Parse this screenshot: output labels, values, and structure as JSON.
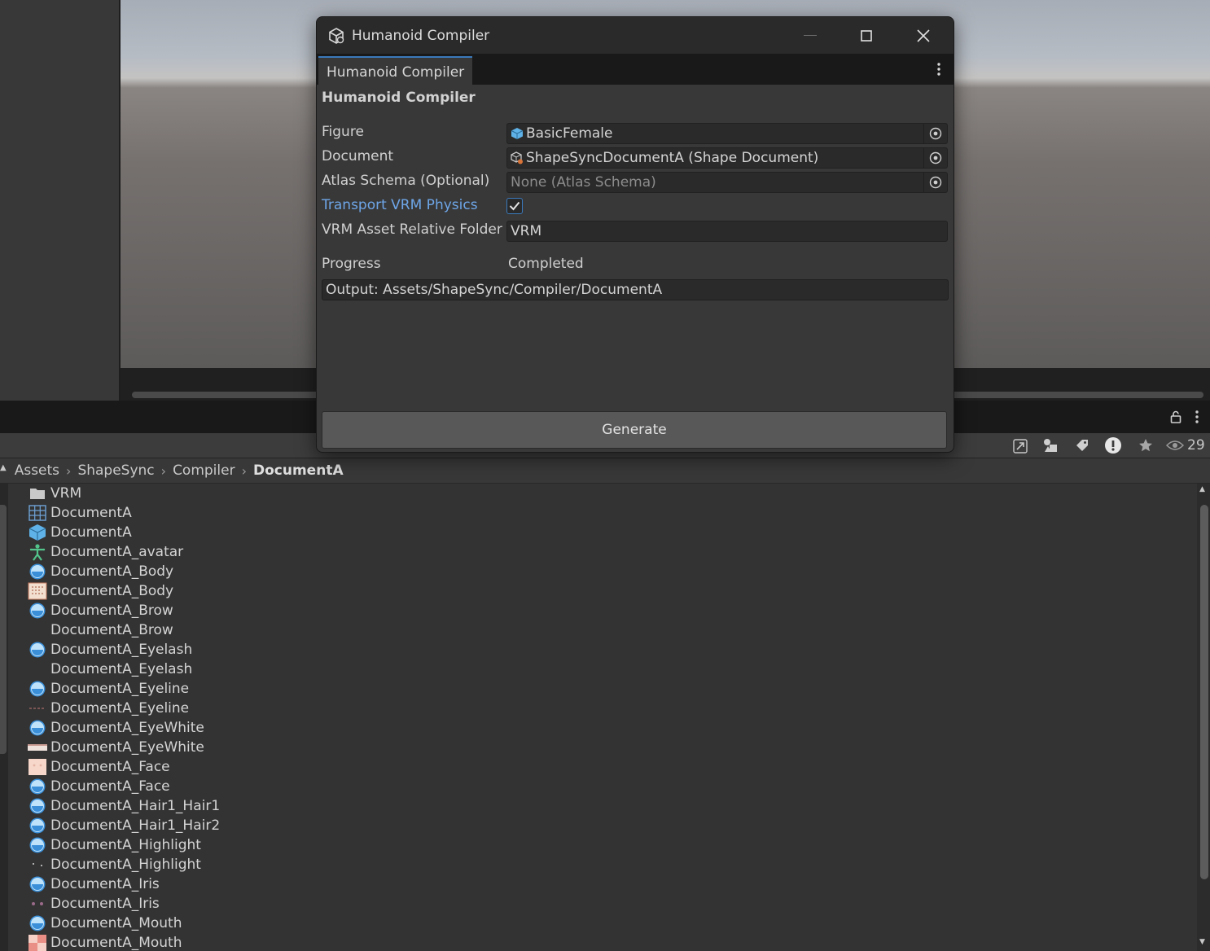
{
  "window": {
    "title": "Humanoid Compiler",
    "tab_label": "Humanoid Compiler",
    "header": "Humanoid Compiler",
    "fields": {
      "figure": {
        "label": "Figure",
        "value": "BasicFemale"
      },
      "document": {
        "label": "Document",
        "value": "ShapeSyncDocumentA (Shape Document)"
      },
      "atlas_schema": {
        "label": "Atlas Schema (Optional)",
        "value": "None (Atlas Schema)"
      },
      "transport": {
        "label": "Transport VRM Physics",
        "checked": true
      },
      "vrm_folder": {
        "label": "VRM Asset Relative Folder",
        "value": "VRM"
      }
    },
    "progress": {
      "label": "Progress",
      "value": "Completed"
    },
    "output": "Output: Assets/ShapeSync/Compiler/DocumentA",
    "generate_label": "Generate"
  },
  "toolbar": {
    "hidden_count": "29"
  },
  "breadcrumb": [
    "Assets",
    "ShapeSync",
    "Compiler",
    "DocumentA"
  ],
  "files": [
    {
      "name": "VRM",
      "icon": "folder-icon"
    },
    {
      "name": "DocumentA",
      "icon": "grid-icon"
    },
    {
      "name": "DocumentA",
      "icon": "prefab-icon"
    },
    {
      "name": "DocumentA_avatar",
      "icon": "avatar-icon"
    },
    {
      "name": "DocumentA_Body",
      "icon": "material-icon"
    },
    {
      "name": "DocumentA_Body",
      "icon": "texture-icon"
    },
    {
      "name": "DocumentA_Brow",
      "icon": "material-icon"
    },
    {
      "name": "DocumentA_Brow",
      "icon": "blank-texture-icon"
    },
    {
      "name": "DocumentA_Eyelash",
      "icon": "material-icon"
    },
    {
      "name": "DocumentA_Eyelash",
      "icon": "blank-texture-icon"
    },
    {
      "name": "DocumentA_Eyeline",
      "icon": "material-icon"
    },
    {
      "name": "DocumentA_Eyeline",
      "icon": "eyeline-texture-icon"
    },
    {
      "name": "DocumentA_EyeWhite",
      "icon": "material-icon"
    },
    {
      "name": "DocumentA_EyeWhite",
      "icon": "eyewhite-texture-icon"
    },
    {
      "name": "DocumentA_Face",
      "icon": "face-texture-icon"
    },
    {
      "name": "DocumentA_Face",
      "icon": "material-icon"
    },
    {
      "name": "DocumentA_Hair1_Hair1",
      "icon": "material-icon"
    },
    {
      "name": "DocumentA_Hair1_Hair2",
      "icon": "material-icon"
    },
    {
      "name": "DocumentA_Highlight",
      "icon": "material-icon"
    },
    {
      "name": "DocumentA_Highlight",
      "icon": "highlight-texture-icon"
    },
    {
      "name": "DocumentA_Iris",
      "icon": "material-icon"
    },
    {
      "name": "DocumentA_Iris",
      "icon": "iris-texture-icon"
    },
    {
      "name": "DocumentA_Mouth",
      "icon": "material-icon"
    },
    {
      "name": "DocumentA_Mouth",
      "icon": "mouth-texture-icon"
    }
  ],
  "colors": {
    "accent": "#3a79bb",
    "link_label": "#6ea6e8",
    "window_bg": "#383838"
  }
}
